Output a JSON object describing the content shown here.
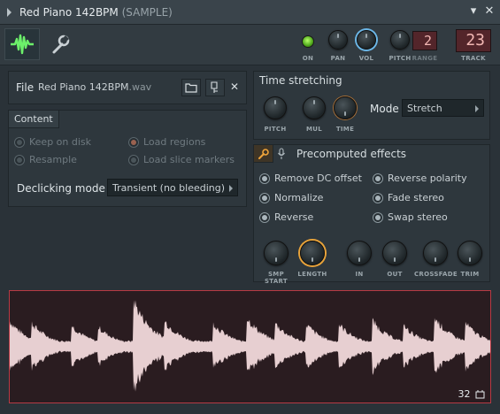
{
  "window": {
    "title": "Red Piano 142BPM",
    "subtitle": "(SAMPLE)",
    "menu_glyph": "▾",
    "close_glyph": "✕"
  },
  "toolbar": {
    "tabs": [
      {
        "name": "waveform-tab",
        "icon": "waveform-icon"
      },
      {
        "name": "settings-tab",
        "icon": "wrench-icon"
      }
    ],
    "on_label": "ON",
    "pan_label": "PAN",
    "vol_label": "VOL",
    "pitch_label": "PITCH",
    "range_label": "RANGE",
    "range_value": "2",
    "track_label": "TRACK",
    "track_value": "23"
  },
  "file": {
    "label": "File",
    "name": "Red Piano 142BPM",
    "ext": ".wav",
    "buttons": [
      "folder-icon",
      "load-icon",
      "close-icon"
    ],
    "close_glyph": "✕"
  },
  "content": {
    "tab": "Content",
    "options": [
      {
        "label": "Keep on disk",
        "state": "disabled"
      },
      {
        "label": "Load regions",
        "state": "disabled-selected"
      },
      {
        "label": "Resample",
        "state": "disabled"
      },
      {
        "label": "Load slice markers",
        "state": "disabled"
      }
    ],
    "declicking_label": "Declicking mode",
    "declicking_value": "Transient (no bleeding)"
  },
  "time_stretching": {
    "tab": "Time stretching",
    "knobs": [
      "PITCH",
      "MUL",
      "TIME"
    ],
    "mode_label": "Mode",
    "mode_value": "Stretch"
  },
  "precomputed": {
    "tab": "Precomputed effects",
    "options_left": [
      "Remove DC offset",
      "Normalize",
      "Reverse"
    ],
    "options_right": [
      "Reverse polarity",
      "Fade stereo",
      "Swap stereo"
    ],
    "knobs": [
      "SMP START",
      "LENGTH",
      "IN",
      "OUT",
      "CROSSFADE",
      "TRIM"
    ]
  },
  "waveform": {
    "count": "32",
    "accent": "#b83a44",
    "wave_color": "#e7cfd1"
  }
}
